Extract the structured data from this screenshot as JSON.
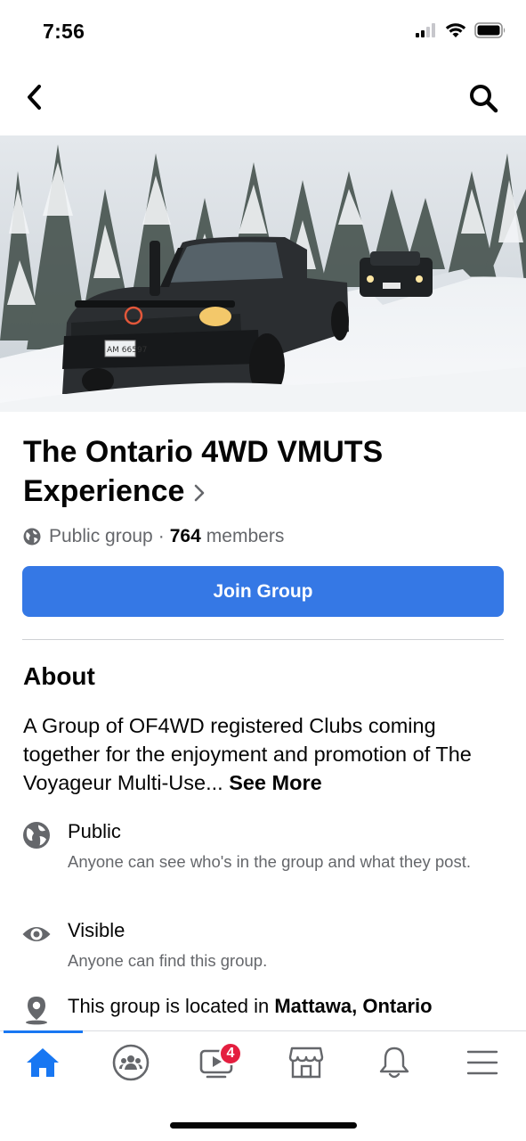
{
  "status_bar": {
    "time": "7:56",
    "icons": [
      "signal-icon",
      "wifi-icon",
      "battery-icon"
    ]
  },
  "nav": {
    "back_icon": "chevron-left-icon",
    "search_icon": "search-icon"
  },
  "cover": {
    "plate_text": "AM 66597"
  },
  "group": {
    "title": "The Ontario 4WD VMUTS Experience",
    "privacy": "Public group",
    "separator": "·",
    "member_count": "764",
    "members_label": "members",
    "join_label": "Join Group"
  },
  "about": {
    "heading": "About",
    "description": " A Group of OF4WD registered Clubs coming together for the enjoyment and promotion of The Voyageur Multi-Use...",
    "see_more": "See More",
    "items": [
      {
        "icon": "globe-icon",
        "title": "Public",
        "subtitle": "Anyone can see who's in the group and what they post."
      },
      {
        "icon": "eye-icon",
        "title": "Visible",
        "subtitle": "Anyone can find this group."
      },
      {
        "icon": "location-pin-icon",
        "title_prefix": "This group is located in ",
        "title_location": "Mattawa, Ontario"
      }
    ]
  },
  "tabs": [
    {
      "name": "home",
      "icon": "home-icon",
      "active": true
    },
    {
      "name": "groups",
      "icon": "groups-icon"
    },
    {
      "name": "watch",
      "icon": "video-icon",
      "badge": "4"
    },
    {
      "name": "marketplace",
      "icon": "marketplace-icon"
    },
    {
      "name": "notifications",
      "icon": "bell-icon"
    },
    {
      "name": "menu",
      "icon": "menu-icon"
    }
  ],
  "colors": {
    "accent": "#3578e5",
    "active_tab": "#1877f2",
    "badge": "#e41e3f",
    "secondary_text": "#65676b"
  }
}
